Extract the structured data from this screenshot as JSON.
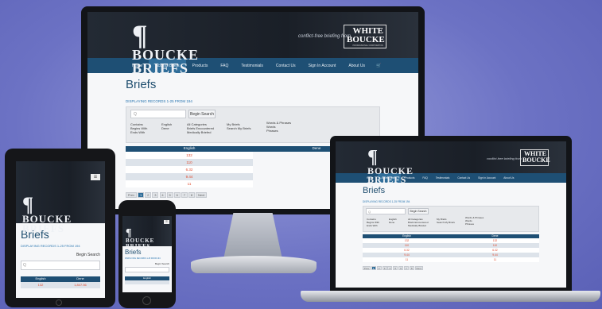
{
  "brand": {
    "name_line1": "BOUCKE",
    "name_line2": "BRIEFS",
    "tagline": "conflict-free briefing from",
    "partner_line1": "WHITE",
    "partner_line2": "BOUCKE",
    "partner_line3": "PROFESSIONAL CORPORATION"
  },
  "nav": {
    "items": [
      "Home",
      "Access Briefs",
      "Products",
      "FAQ",
      "Testimonials",
      "Contact Us",
      "Sign In Account",
      "About Us"
    ],
    "active_index": 1
  },
  "page": {
    "title": "Briefs",
    "count_text": "Displaying records 1-25 from 194"
  },
  "search": {
    "placeholder": "Q",
    "button_label": "Begin Search",
    "match_options": [
      "Contains",
      "Begins With",
      "Ends With"
    ],
    "language_options": [
      "English",
      "Dene"
    ],
    "category_options": [
      "All Categories",
      "Briefs Encountered",
      "Medically Briefed"
    ],
    "scope_options": [
      "My Briefs",
      "Search My Briefs"
    ],
    "field_options": [
      "Words & Phrases",
      "Words",
      "Phrases"
    ]
  },
  "table": {
    "columns": [
      "English",
      "Dene"
    ],
    "rows": [
      [
        "132",
        "132"
      ],
      [
        "110",
        "110"
      ],
      [
        "6.32",
        "6.32"
      ],
      [
        "9.44",
        "9.44"
      ],
      [
        "11",
        "11"
      ]
    ]
  },
  "pager": {
    "pages": [
      "Prev",
      "1",
      "2",
      "3",
      "4",
      "5",
      "6",
      "7",
      "8",
      "Next"
    ],
    "active_index": 1
  },
  "phone": {
    "title": "Briefs",
    "count_text": "Displaying records 1-25 from 194",
    "button_label": "Begin Search",
    "col": "English"
  },
  "tablet": {
    "title": "Briefs",
    "count_text": "Displaying records 1-25 from 194",
    "button_label": "Begin Search",
    "columns": [
      "English",
      "Dene"
    ],
    "row": [
      "132",
      "1,847.56"
    ]
  },
  "colors": {
    "nav": "#1e4f74",
    "accent": "#2a76b0",
    "header_dark": "#1a1f27",
    "value_red": "#e04b2f"
  }
}
